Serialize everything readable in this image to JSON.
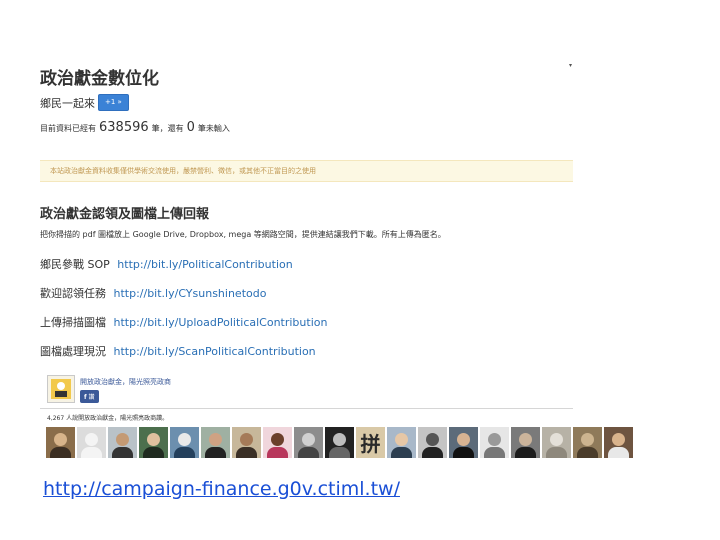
{
  "header": {
    "title": "政治獻金數位化",
    "subtitle": "鄉民一起來",
    "plus_button": "+1 »",
    "count_prefix": "目前資料已經有",
    "count_total": "638596",
    "count_middle": "筆，還有",
    "count_remaining": "0",
    "count_suffix": "筆未輸入",
    "corner_mark": "▾"
  },
  "alert": {
    "text": "本站政治獻金資料收集僅供學術交流使用，嚴禁營利、徵信，或其他不正當目的之使用"
  },
  "section": {
    "title": "政治獻金認領及圖檔上傳回報",
    "description": "把你掃描的 pdf 圖檔放上 Google Drive, Dropbox, mega 等網路空間，提供連結讓我們下載。所有上傳為匿名。",
    "links": [
      {
        "label": "鄉民參戰 SOP",
        "url": "http://bit.ly/PoliticalContribution"
      },
      {
        "label": "歡迎認領任務",
        "url": "http://bit.ly/CYsunshinetodo"
      },
      {
        "label": "上傳掃描圖檔",
        "url": "http://bit.ly/UploadPoliticalContribution"
      },
      {
        "label": "圖檔處理現況",
        "url": "http://bit.ly/ScanPoliticalContribution"
      }
    ]
  },
  "facebook": {
    "page_name": "開放政治獻金，陽光照亮政商",
    "like_label": "讚",
    "like_count_text": "4,267 人說開放政治獻金，陽光照亮政商讚。",
    "char_face": "拼"
  },
  "footer": {
    "url": "http://campaign-finance.g0v.ctiml.tw/"
  },
  "colors": {
    "link": "#2a6fb5",
    "button": "#3b82d6",
    "facebook": "#3b5998",
    "alert_bg": "#fcf8e3",
    "alert_text": "#c09853"
  }
}
